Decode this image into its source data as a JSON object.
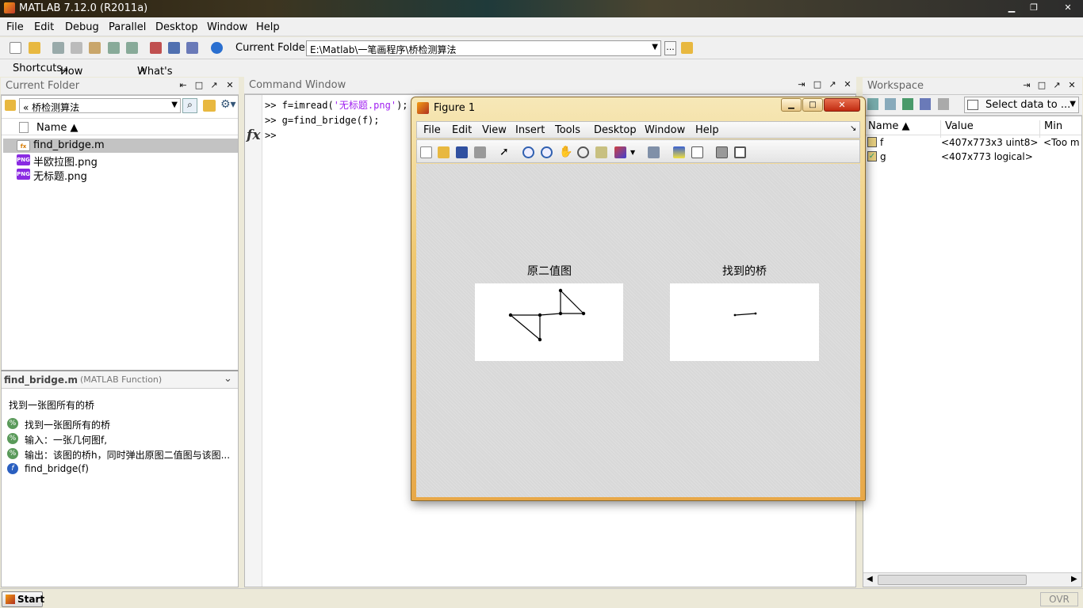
{
  "window": {
    "title": "MATLAB  7.12.0 (R2011a)"
  },
  "menu": [
    "File",
    "Edit",
    "Debug",
    "Parallel",
    "Desktop",
    "Window",
    "Help"
  ],
  "toolbar": {
    "current_folder_label": "Current Folder:",
    "current_folder_path": "E:\\Matlab\\一笔画程序\\桥检测算法",
    "browse_label": "..."
  },
  "shortcuts": {
    "items": [
      "Shortcuts",
      "How to Add",
      "What's New"
    ]
  },
  "current_folder": {
    "title": "Current Folder",
    "path_label": "« 桥检测算法",
    "column_name": "Name ▲",
    "files": [
      {
        "name": "find_bridge.m",
        "type": "m"
      },
      {
        "name": "半欧拉图.png",
        "type": "png"
      },
      {
        "name": "无标题.png",
        "type": "png"
      }
    ],
    "details": {
      "file": "find_bridge.m",
      "kind": "(MATLAB Function)",
      "summary": "找到一张图所有的桥",
      "lines": [
        "找到一张图所有的桥",
        "输入：一张几何图f,",
        "输出：该图的桥h，同时弹出原图二值图与该图...",
        "find_bridge(f)"
      ]
    }
  },
  "command_window": {
    "title": "Command Window",
    "lines": [
      {
        "prompt": ">>",
        "code1": " f=imread(",
        "str": "'无标题.png'",
        "code2": ");"
      },
      {
        "prompt": ">>",
        "code1": " g=find_bridge(f);",
        "str": "",
        "code2": ""
      }
    ],
    "prompt": ">>",
    "fx": "fx"
  },
  "figure": {
    "title": "Figure 1",
    "menu": [
      "File",
      "Edit",
      "View",
      "Insert",
      "Tools",
      "Desktop",
      "Window",
      "Help"
    ],
    "axes": [
      {
        "title": "原二值图"
      },
      {
        "title": "找到的桥"
      }
    ]
  },
  "workspace": {
    "title": "Workspace",
    "select_data": "Select data to ...",
    "columns": [
      "Name ▲",
      "Value",
      "Min"
    ],
    "vars": [
      {
        "name": "f",
        "value": "<407x773x3 uint8>",
        "min": "<Too m"
      },
      {
        "name": "g",
        "value": "<407x773 logical>",
        "min": ""
      }
    ]
  },
  "status": {
    "start": "Start",
    "ovr": "OVR"
  },
  "colors": {
    "accent": "#d77b00",
    "string": "#a020f0",
    "selection": "#c3c3c3"
  }
}
